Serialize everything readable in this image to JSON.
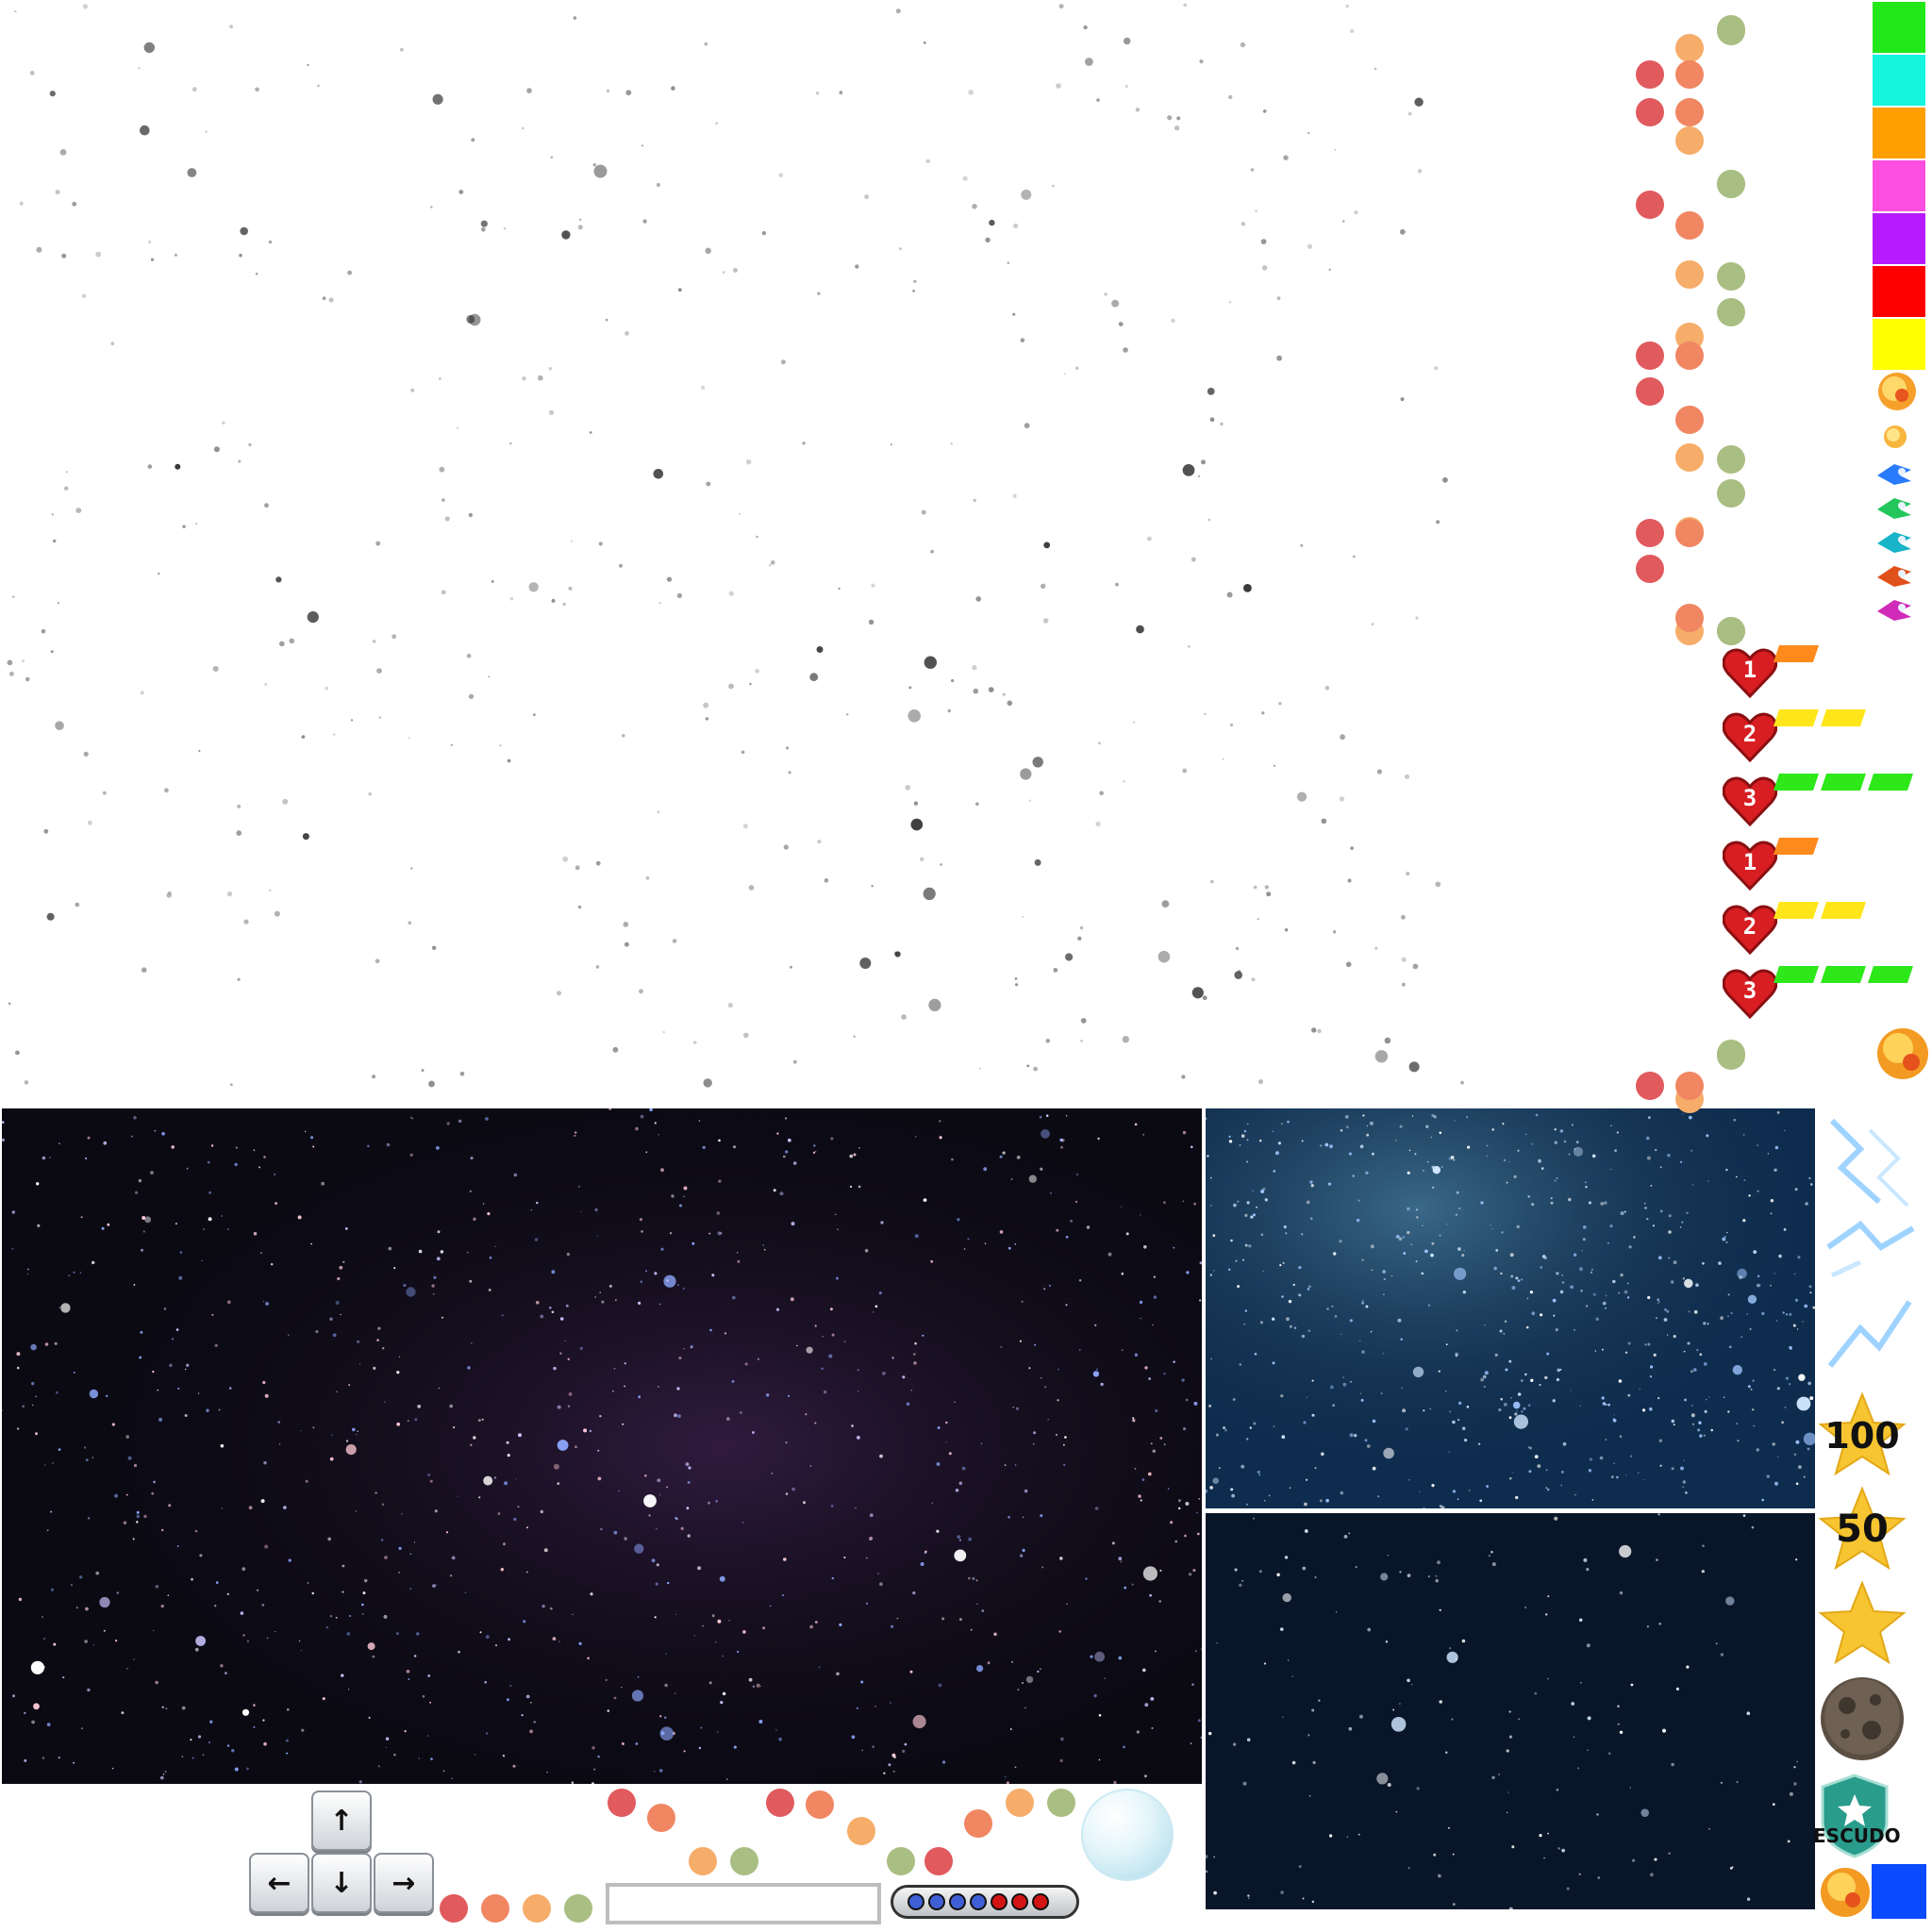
{
  "palette": {
    "swatches": [
      "#22e81a",
      "#14f4de",
      "#ff9f00",
      "#ff4fe0",
      "#b61bff",
      "#ff0000",
      "#ffff00"
    ],
    "dot_red": "#e05a5e",
    "dot_salmon": "#f08662",
    "dot_orange": "#f6ad6a",
    "dot_olive": "#a9be82",
    "space_dark": "#0b0a13",
    "space_blue": "#0e2d4e",
    "space_navy": "#09162a"
  },
  "health": {
    "hearts": [
      {
        "label": "1",
        "fill": 1,
        "color": "#ff8a1c"
      },
      {
        "label": "2",
        "fill": 2,
        "color": "#ffe61a"
      },
      {
        "label": "3",
        "fill": 3,
        "color": "#2ee81a"
      },
      {
        "label": "1",
        "fill": 1,
        "color": "#ff8a1c"
      },
      {
        "label": "2",
        "fill": 2,
        "color": "#ffe61a"
      },
      {
        "label": "3",
        "fill": 3,
        "color": "#2ee81a"
      }
    ]
  },
  "pickups": {
    "star_100": "100",
    "star_50": "50",
    "shield_label": "ESCUDO"
  },
  "controls": {
    "key_up": "↑",
    "key_left": "←",
    "key_down": "↓",
    "key_right": "→"
  },
  "ammo": {
    "blue_count": 4,
    "red_count": 3
  },
  "icons": [
    "explosion-icon",
    "spaceship-icon",
    "laser-icon",
    "asteroid-icon",
    "shield-icon",
    "bubble-icon",
    "heart-icon",
    "star-icon"
  ]
}
